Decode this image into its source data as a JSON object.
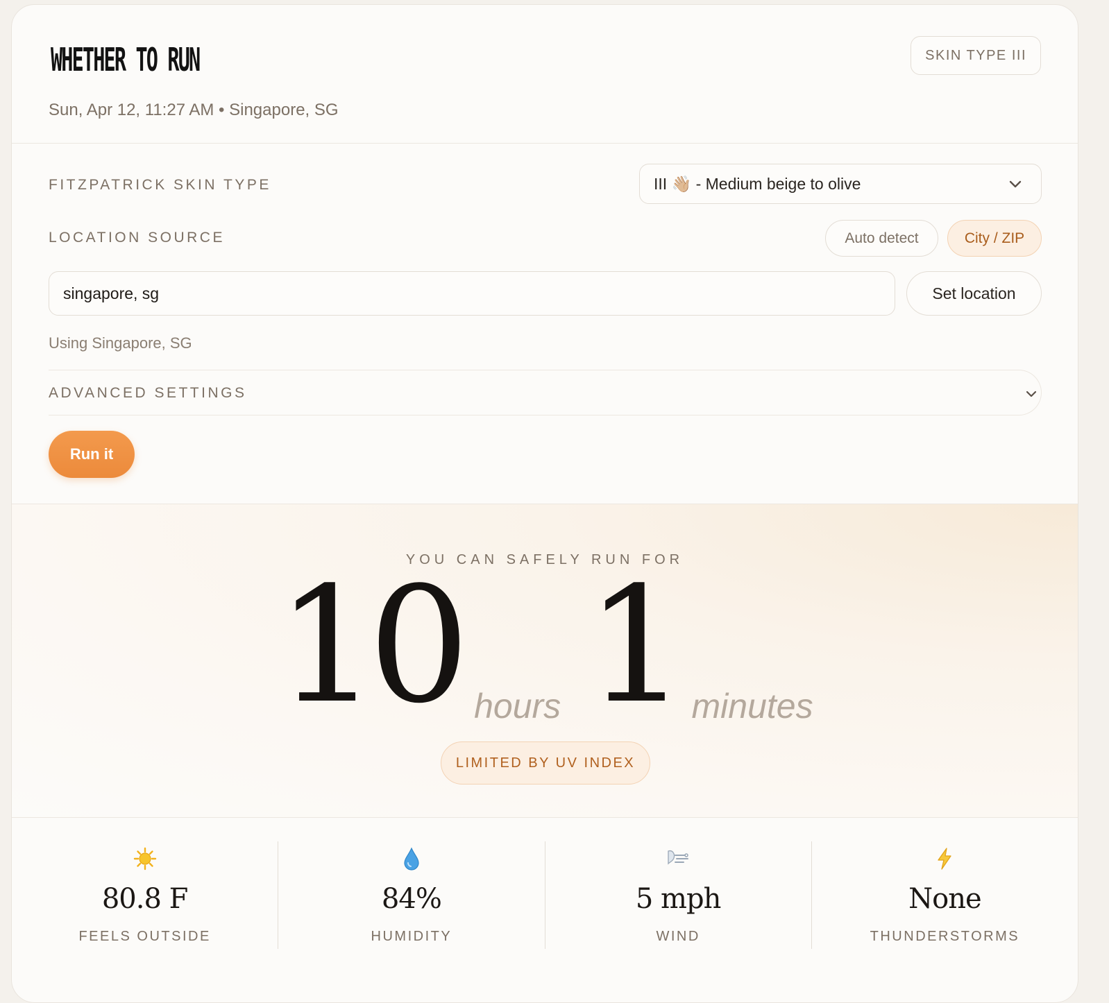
{
  "header": {
    "title": "WHETHER TO RUN",
    "subtitle": "Sun, Apr 12, 11:27 AM • Singapore, SG",
    "skin_badge": "SKIN TYPE III"
  },
  "settings": {
    "skin_type_label": "FITZPATRICK SKIN TYPE",
    "skin_type_value": "III 👋🏼 - Medium beige to olive",
    "location_source_label": "LOCATION SOURCE",
    "location_options": [
      {
        "label": "Auto detect",
        "active": false
      },
      {
        "label": "City / ZIP",
        "active": true
      }
    ],
    "location_input_value": "singapore, sg",
    "set_location_label": "Set location",
    "using_text": "Using Singapore, SG",
    "advanced_label": "ADVANCED SETTINGS",
    "run_label": "Run it"
  },
  "result": {
    "caption": "YOU CAN SAFELY RUN FOR",
    "hours_value": "10",
    "hours_unit": "hours",
    "minutes_value": "1",
    "minutes_unit": "minutes",
    "limit_badge": "LIMITED BY UV INDEX"
  },
  "stats": [
    {
      "icon": "sun-icon",
      "value": "80.8 F",
      "label": "FEELS OUTSIDE"
    },
    {
      "icon": "droplet-icon",
      "value": "84%",
      "label": "HUMIDITY"
    },
    {
      "icon": "wind-icon",
      "value": "5 mph",
      "label": "WIND"
    },
    {
      "icon": "lightning-icon",
      "value": "None",
      "label": "THUNDERSTORMS"
    }
  ],
  "colors": {
    "accent": "#ec8a3b",
    "accent_soft": "#fcefe2",
    "text_muted": "#7c7064"
  }
}
